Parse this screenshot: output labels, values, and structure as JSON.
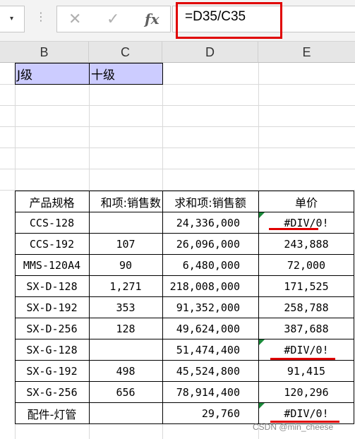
{
  "formula_bar": {
    "formula": "=D35/C35",
    "fx_label": "fx",
    "cancel_icon": "✕",
    "enter_icon": "✓",
    "namebox_arrow": "▾",
    "separator": "⋮"
  },
  "columns": [
    "B",
    "C",
    "D",
    "E"
  ],
  "top_cells": {
    "b": "J级",
    "c": "十级"
  },
  "pivot": {
    "headers": [
      "产品规格",
      "和项:销售数",
      "求和项:销售额",
      "单价"
    ],
    "rows": [
      {
        "spec": "CCS-128",
        "qty": "",
        "amount": "24,336,000",
        "price": "#DIV/0!"
      },
      {
        "spec": "CCS-192",
        "qty": "107",
        "amount": "26,096,000",
        "price": "243,888"
      },
      {
        "spec": "MMS-120A4",
        "qty": "90",
        "amount": "6,480,000",
        "price": "72,000"
      },
      {
        "spec": "SX-D-128",
        "qty": "1,271",
        "amount": "218,008,000",
        "price": "171,525"
      },
      {
        "spec": "SX-D-192",
        "qty": "353",
        "amount": "91,352,000",
        "price": "258,788"
      },
      {
        "spec": "SX-D-256",
        "qty": "128",
        "amount": "49,624,000",
        "price": "387,688"
      },
      {
        "spec": "SX-G-128",
        "qty": "",
        "amount": "51,474,400",
        "price": "#DIV/0!"
      },
      {
        "spec": "SX-G-192",
        "qty": "498",
        "amount": "45,524,800",
        "price": "91,415"
      },
      {
        "spec": "SX-G-256",
        "qty": "656",
        "amount": "78,914,400",
        "price": "120,296"
      },
      {
        "spec": "配件-灯管",
        "qty": "",
        "amount": "29,760",
        "price": "#DIV/0!"
      }
    ]
  },
  "watermark": "CSDN @min_cheese",
  "colors": {
    "highlight_red": "#e00000",
    "header_purple": "#ccccff",
    "error_flag_green": "#1a8a3a"
  }
}
